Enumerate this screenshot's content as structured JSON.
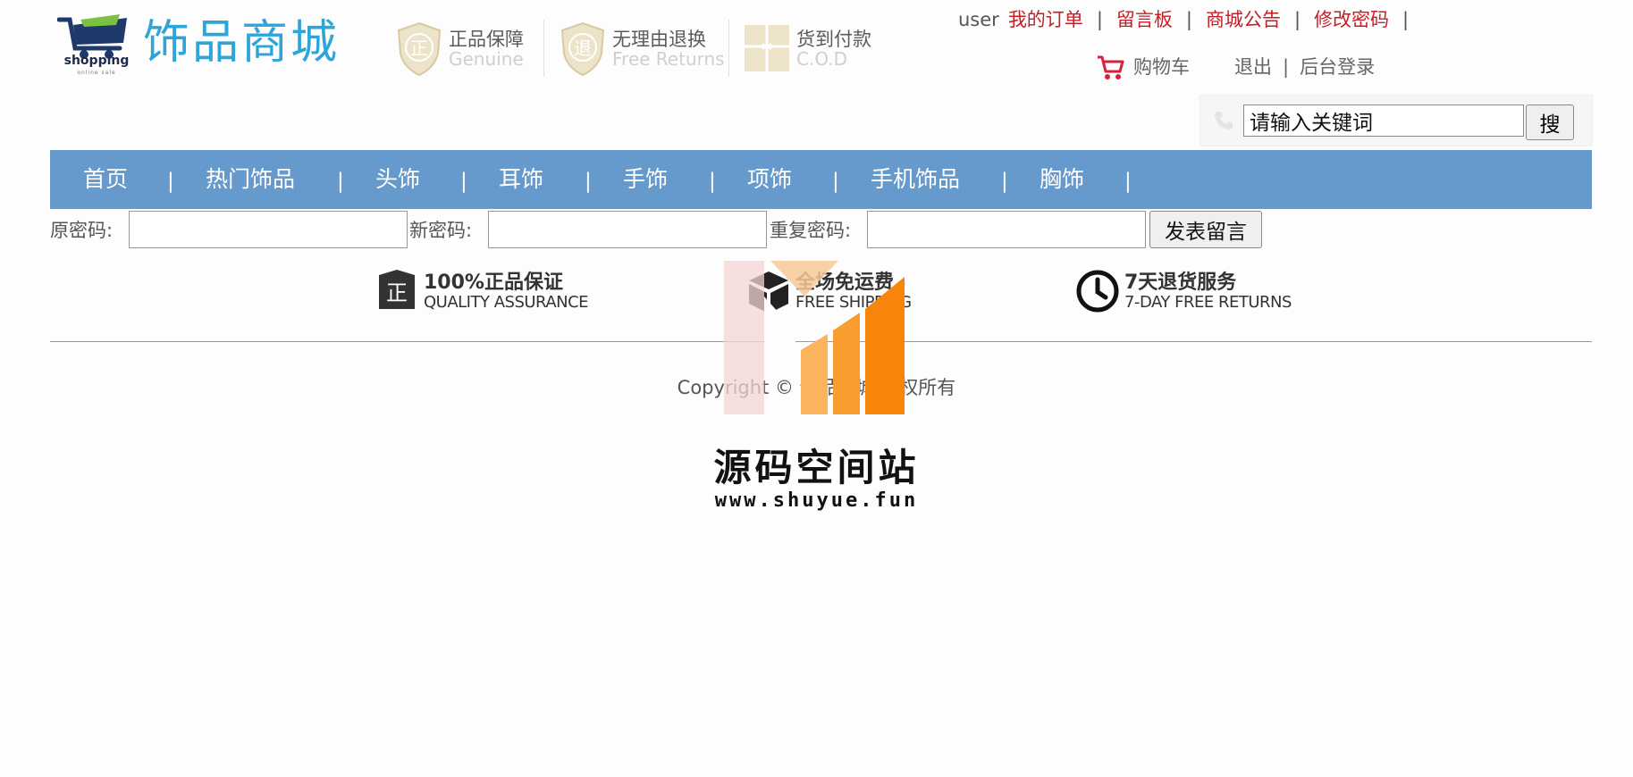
{
  "header": {
    "logo": {
      "word": "shopping",
      "sub": "online sale",
      "title": "饰品商城"
    },
    "badges": [
      {
        "glyph": "正",
        "main": "正品保障",
        "sub": "Genuine"
      },
      {
        "glyph": "退",
        "main": "无理由退换",
        "sub": "Free Returns"
      },
      {
        "glyph": "✲",
        "main": "货到付款",
        "sub": "C.O.D"
      }
    ],
    "user": "user",
    "links": [
      "我的订单",
      "留言板",
      "商城公告",
      "修改密码"
    ],
    "cart_label": "购物车",
    "logout_label": "退出",
    "admin_login_label": "后台登录",
    "search": {
      "placeholder": "请输入关键词",
      "value": "请输入关键词",
      "button_label": "搜"
    }
  },
  "nav": {
    "items": [
      "首页",
      "热门饰品",
      "头饰",
      "耳饰",
      "手饰",
      "项饰",
      "手机饰品",
      "胸饰"
    ],
    "separator": "|"
  },
  "password_form": {
    "old_label": "原密码:",
    "new_label": "新密码:",
    "repeat_label": "重复密码:",
    "submit_label": "发表留言"
  },
  "guarantees": [
    {
      "icon": "shield-icon",
      "main": "100%正品保证",
      "sub": "QUALITY ASSURANCE"
    },
    {
      "icon": "box-icon",
      "main": "全场免运费",
      "sub": "FREE SHIPPING"
    },
    {
      "icon": "clock-icon",
      "main": "7天退货服务",
      "sub": "7-DAY FREE RETURNS"
    }
  ],
  "footer": {
    "copyright": "Copyright © 饰品商城 版权所有"
  },
  "watermark": {
    "title": "源码空间站",
    "url": "www.shuyue.fun"
  },
  "colors": {
    "nav_bg": "#6699cc",
    "link_red": "#c81d25",
    "logo_blue": "#2da5d8",
    "cart_green": "#7cc242",
    "watermark_orange": "#f7850a"
  }
}
